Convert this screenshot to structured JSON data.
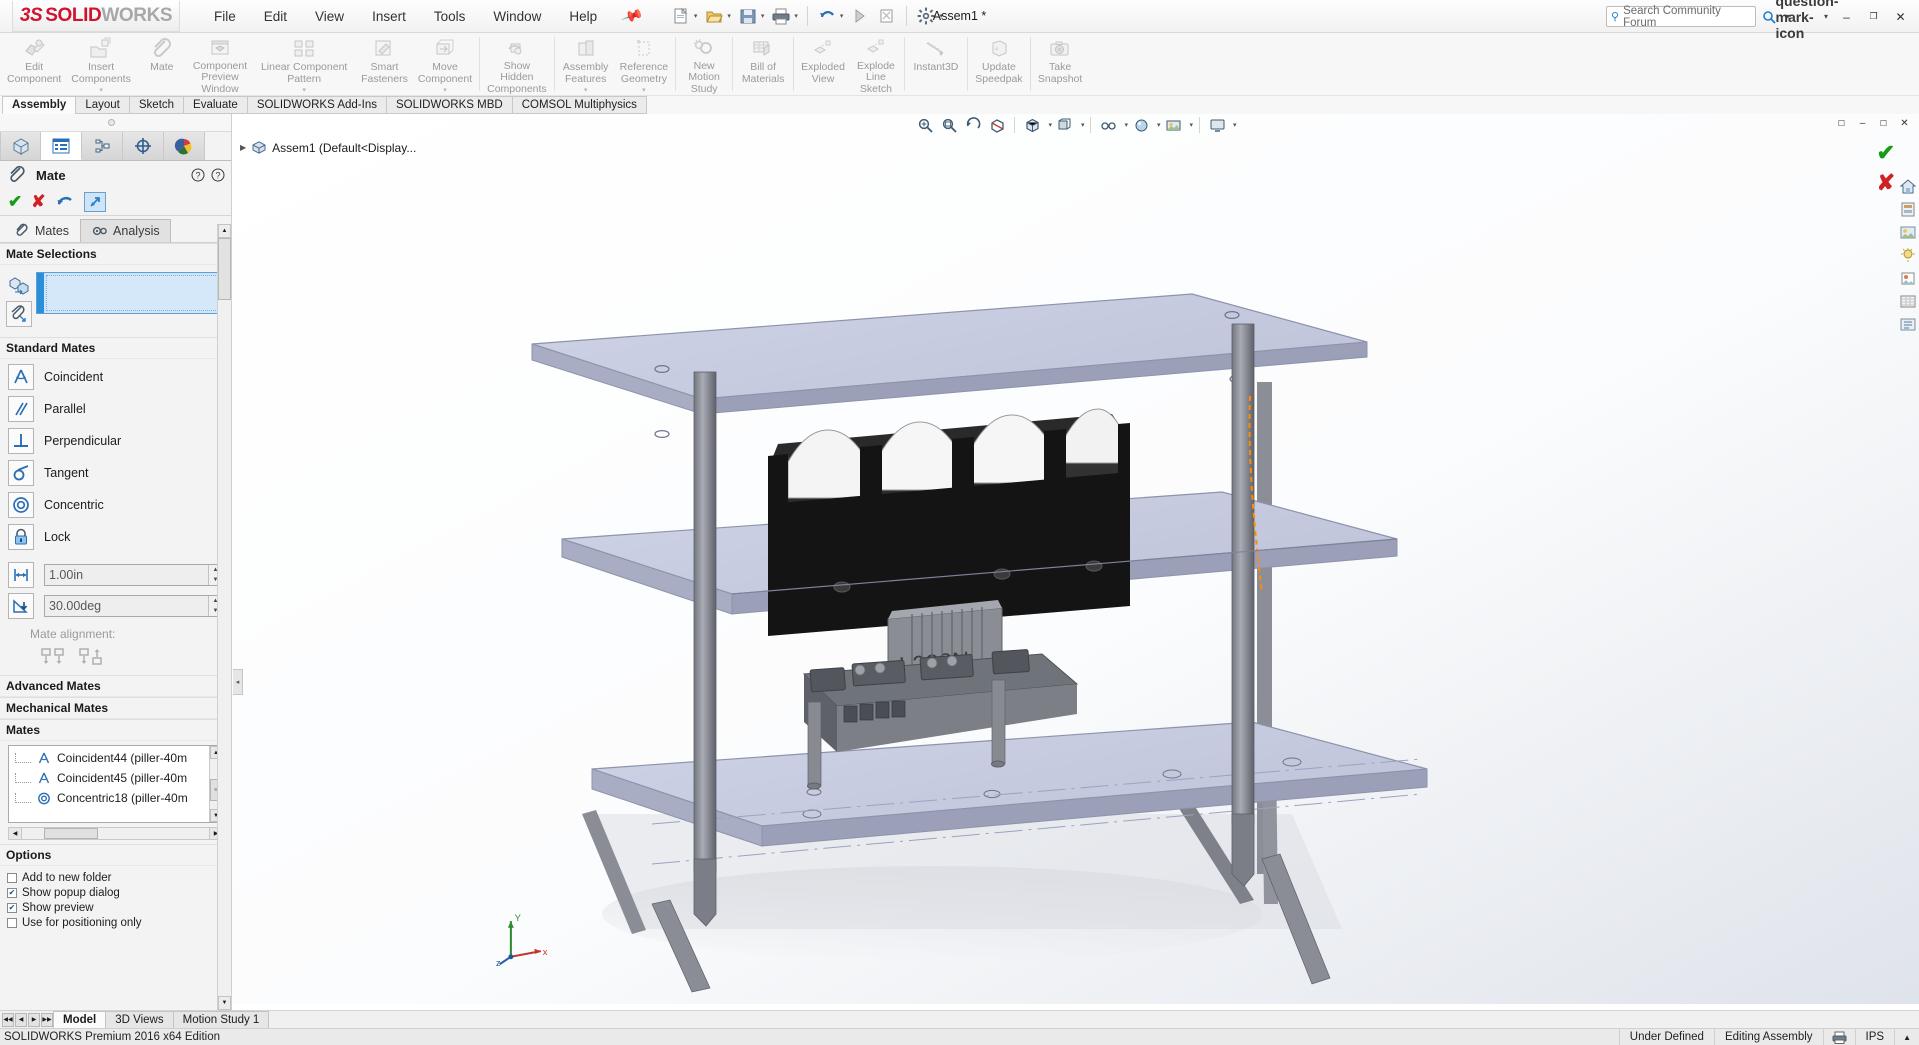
{
  "window": {
    "title": "Assem1 *",
    "minimize_label": "–",
    "maximize_label": "❐",
    "close_label": "✕"
  },
  "brand": {
    "ds": "ũ3S",
    "solid": "SOLID",
    "works": "WORKS"
  },
  "menu": {
    "items": [
      "File",
      "Edit",
      "View",
      "Insert",
      "Tools",
      "Window",
      "Help"
    ],
    "pin_icon": "pushpin-icon"
  },
  "quick_access": [
    {
      "name": "new-document-button",
      "icon": "new-document-icon",
      "has_caret": true
    },
    {
      "name": "open-document-button",
      "icon": "open-folder-icon",
      "has_caret": true
    },
    {
      "name": "save-button",
      "icon": "floppy-save-icon",
      "has_caret": true
    },
    {
      "name": "print-button",
      "icon": "printer-icon",
      "has_caret": true
    },
    {
      "name": "undo-button",
      "icon": "undo-arrow-icon",
      "has_caret": true
    },
    {
      "name": "rebuild-button",
      "icon": "rebuild-stoplight-icon",
      "has_caret": false
    },
    {
      "name": "close-document-button",
      "icon": "close-doc-icon",
      "has_caret": false
    },
    {
      "name": "options-button",
      "icon": "gear-icon",
      "has_caret": true
    }
  ],
  "search": {
    "placeholder": "Search Community Forum",
    "icon": "magnifier-icon",
    "caret": "▾"
  },
  "titlebar_right": {
    "help_icon": "question-mark-icon",
    "help_caret": "▾"
  },
  "ribbon": {
    "groups": [
      {
        "buttons": [
          {
            "label": "Edit\nComponent",
            "icon": "edit-component-icon",
            "caret": false
          },
          {
            "label": "Insert\nComponents",
            "icon": "insert-components-icon",
            "caret": true
          },
          {
            "label": "Mate",
            "icon": "paperclip-mate-icon",
            "caret": false
          },
          {
            "label": "Component\nPreview\nWindow",
            "icon": "component-preview-icon",
            "caret": false
          },
          {
            "label": "Linear Component\nPattern",
            "icon": "linear-pattern-icon",
            "caret": true
          },
          {
            "label": "Smart\nFasteners",
            "icon": "smart-fasteners-icon",
            "caret": false
          },
          {
            "label": "Move\nComponent",
            "icon": "move-component-icon",
            "caret": true
          }
        ]
      },
      {
        "buttons": [
          {
            "label": "Show\nHidden\nComponents",
            "icon": "show-hidden-icon",
            "caret": false
          }
        ]
      },
      {
        "buttons": [
          {
            "label": "Assembly\nFeatures",
            "icon": "assembly-features-icon",
            "caret": true
          },
          {
            "label": "Reference\nGeometry",
            "icon": "reference-geometry-icon",
            "caret": true
          }
        ]
      },
      {
        "buttons": [
          {
            "label": "New\nMotion\nStudy",
            "icon": "new-motion-study-icon",
            "caret": false
          }
        ]
      },
      {
        "buttons": [
          {
            "label": "Bill of\nMaterials",
            "icon": "bill-of-materials-icon",
            "caret": false
          }
        ]
      },
      {
        "buttons": [
          {
            "label": "Exploded\nView",
            "icon": "exploded-view-icon",
            "caret": false
          },
          {
            "label": "Explode\nLine\nSketch",
            "icon": "explode-line-sketch-icon",
            "caret": false
          }
        ]
      },
      {
        "buttons": [
          {
            "label": "Instant3D",
            "icon": "instant3d-icon",
            "caret": false
          }
        ]
      },
      {
        "buttons": [
          {
            "label": "Update\nSpeedpak",
            "icon": "update-speedpak-icon",
            "caret": false
          }
        ]
      },
      {
        "buttons": [
          {
            "label": "Take\nSnapshot",
            "icon": "camera-snapshot-icon",
            "caret": false
          }
        ]
      }
    ]
  },
  "tabs": {
    "items": [
      "Assembly",
      "Layout",
      "Sketch",
      "Evaluate",
      "SOLIDWORKS Add-Ins",
      "SOLIDWORKS MBD",
      "COMSOL Multiphysics"
    ],
    "active_index": 0
  },
  "property_manager": {
    "panel_tabs": [
      {
        "name": "feature-tree-tab",
        "icon": "feature-tree-icon",
        "active": false
      },
      {
        "name": "property-manager-tab",
        "icon": "property-manager-icon",
        "active": true
      },
      {
        "name": "configuration-manager-tab",
        "icon": "configuration-manager-icon",
        "active": false
      },
      {
        "name": "dimxpert-manager-tab",
        "icon": "crosshair-target-icon",
        "active": false
      },
      {
        "name": "display-manager-tab",
        "icon": "color-palette-icon",
        "active": false
      }
    ],
    "title": "Mate",
    "title_icon": "paperclip-mate-icon",
    "help_icons": [
      "help-bubble-icon",
      "help-question-icon"
    ],
    "actions": [
      {
        "name": "accept-button",
        "glyph": "✔"
      },
      {
        "name": "cancel-button",
        "glyph": "✘"
      },
      {
        "name": "undo-button",
        "glyph": "↶"
      },
      {
        "name": "keep-visible-pin-button",
        "glyph": "↗"
      }
    ],
    "inner_tabs": [
      {
        "label": "Mates",
        "icon": "paperclip-mate-icon",
        "active": true
      },
      {
        "label": "Analysis",
        "icon": "analysis-gears-icon",
        "active": false
      }
    ],
    "mate_selections": {
      "header": "Mate Selections",
      "chevron": "▴",
      "icons": [
        "entities-to-mate-icon",
        "multiple-mate-mode-icon"
      ],
      "field_value": ""
    },
    "standard_mates": {
      "header": "Standard Mates",
      "chevron": "▴",
      "items": [
        {
          "label": "Coincident",
          "icon": "coincident-mate-icon"
        },
        {
          "label": "Parallel",
          "icon": "parallel-mate-icon"
        },
        {
          "label": "Perpendicular",
          "icon": "perpendicular-mate-icon"
        },
        {
          "label": "Tangent",
          "icon": "tangent-mate-icon"
        },
        {
          "label": "Concentric",
          "icon": "concentric-mate-icon"
        },
        {
          "label": "Lock",
          "icon": "lock-mate-icon"
        }
      ],
      "distance": {
        "icon": "distance-mate-icon",
        "value": "1.00in"
      },
      "angle": {
        "icon": "angle-mate-icon",
        "value": "30.00deg"
      },
      "alignment_label": "Mate alignment:",
      "alignment_icons": [
        "aligned-icon",
        "anti-aligned-icon"
      ]
    },
    "advanced_mates": {
      "header": "Advanced Mates",
      "chevron": "▾"
    },
    "mechanical_mates": {
      "header": "Mechanical Mates",
      "chevron": "▾"
    },
    "mates": {
      "header": "Mates",
      "chevron": "▴",
      "rows": [
        {
          "label": "Coincident44 (piller-40m",
          "icon": "coincident-mate-icon"
        },
        {
          "label": "Coincident45 (piller-40m",
          "icon": "coincident-mate-icon"
        },
        {
          "label": "Concentric18 (piller-40m",
          "icon": "concentric-mate-icon"
        }
      ],
      "scroll_up": "▲",
      "scroll_down": "▼",
      "hscroll_left": "◀",
      "hscroll_right": "▶"
    },
    "options": {
      "header": "Options",
      "chevron": "▴",
      "items": [
        {
          "label": "Add to new folder",
          "checked": false
        },
        {
          "label": "Show popup dialog",
          "checked": true
        },
        {
          "label": "Show preview",
          "checked": true
        },
        {
          "label": "Use for positioning only",
          "checked": false
        }
      ],
      "check_glyph": "✔"
    }
  },
  "graphics": {
    "view_toolbar": [
      {
        "name": "zoom-to-fit-button",
        "icon": "magnifier-fit-icon"
      },
      {
        "name": "zoom-to-area-button",
        "icon": "magnifier-area-icon"
      },
      {
        "name": "previous-view-button",
        "icon": "previous-view-icon"
      },
      {
        "name": "section-view-button",
        "icon": "section-view-icon"
      },
      {
        "name": "view-orientation-button",
        "icon": "view-orientation-icon",
        "caret": true
      },
      {
        "name": "display-style-button",
        "icon": "display-style-icon",
        "caret": true
      },
      {
        "name": "hide-show-items-button",
        "icon": "eyeglasses-icon",
        "caret": true
      },
      {
        "name": "edit-appearance-button",
        "icon": "appearance-sphere-icon",
        "caret": true
      },
      {
        "name": "apply-scene-button",
        "icon": "scene-icon",
        "caret": true
      },
      {
        "name": "view-settings-button",
        "icon": "view-settings-icon",
        "caret": true
      }
    ],
    "window_buttons": [
      "❐",
      "–",
      "❐",
      "✕"
    ],
    "tree_root": "Assem1 (Default<Display...",
    "tree_root_icon": "assembly-icon",
    "tree_expander": "▶",
    "confirm_ok": "✔",
    "confirm_cancel": "✘",
    "right_tools": [
      {
        "name": "view-home-button",
        "icon": "home-icon"
      },
      {
        "name": "appearances-button",
        "icon": "appearances-icon"
      },
      {
        "name": "scenes-button",
        "icon": "scenes-icon"
      },
      {
        "name": "lights-cameras-button",
        "icon": "lights-icon"
      },
      {
        "name": "decals-button",
        "icon": "decals-icon"
      },
      {
        "name": "custom-view-button",
        "icon": "custom-view-icon"
      },
      {
        "name": "display-states-button",
        "icon": "display-states-icon"
      }
    ],
    "model_label": "L298N",
    "triad_axes": {
      "x": "x",
      "y": "Y",
      "z": "z"
    }
  },
  "bottom_tabs": {
    "nav_glyphs": [
      "◀◀",
      "◀",
      "▶",
      "▶▶"
    ],
    "items": [
      "Model",
      "3D Views",
      "Motion Study 1"
    ],
    "active_index": 0
  },
  "status_bar": {
    "left": "SOLIDWORKS Premium 2016 x64 Edition",
    "state": "Under Defined",
    "mode": "Editing Assembly",
    "lock_icon": "printer-status-icon",
    "units": "IPS",
    "caret": "▲"
  },
  "colors": {
    "brand_red": "#cf1430",
    "accent_blue": "#2a8fd8",
    "ok_green": "#159c15",
    "cancel_red": "#d02222",
    "panel_bg": "#f3f3f3",
    "ribbon_label": "#9a9a9a",
    "model_plate": "#c3c7dc",
    "model_dark": "#1a1a1a",
    "highlight_orange": "#ff8c00"
  }
}
